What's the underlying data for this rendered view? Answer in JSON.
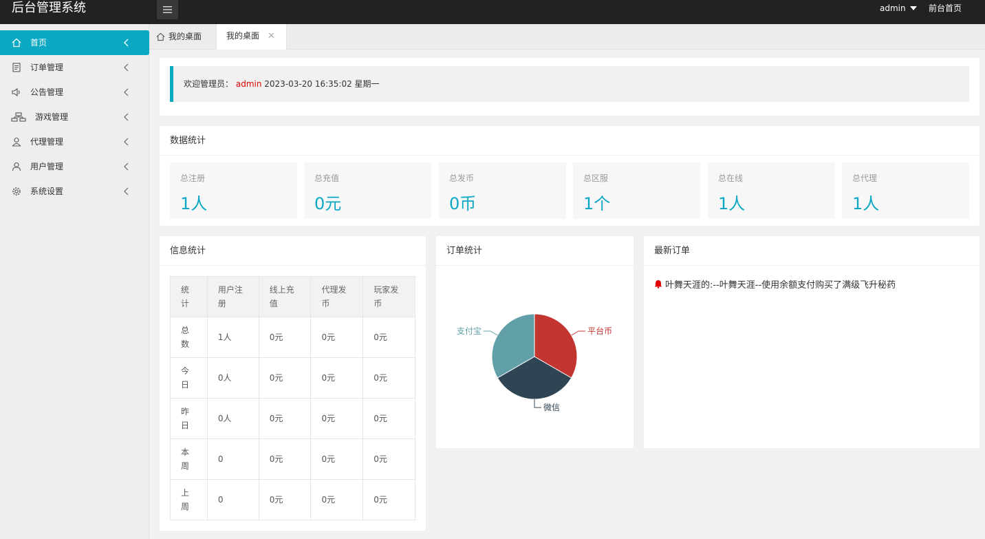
{
  "header": {
    "brand": "后台管理系统",
    "user": "admin",
    "front_home": "前台首页"
  },
  "sidebar": {
    "items": [
      {
        "label": "首页",
        "icon": "home-icon",
        "active": true
      },
      {
        "label": "订单管理",
        "icon": "order-icon",
        "active": false
      },
      {
        "label": "公告管理",
        "icon": "speaker-icon",
        "active": false
      },
      {
        "label": "游戏管理",
        "icon": "sitemap-icon",
        "active": false
      },
      {
        "label": "代理管理",
        "icon": "agent-icon",
        "active": false
      },
      {
        "label": "用户管理",
        "icon": "user-icon",
        "active": false
      },
      {
        "label": "系统设置",
        "icon": "gear-icon",
        "active": false
      }
    ]
  },
  "tabs": {
    "home_label": "我的桌面",
    "active_label": "我的桌面",
    "close_glyph": "✕"
  },
  "welcome": {
    "prefix": "欢迎管理员：",
    "user": "admin",
    "datetime": "2023-03-20  16:35:02  星期一"
  },
  "stats": {
    "title": "数据统计",
    "cards": [
      {
        "label": "总注册",
        "value": "1人"
      },
      {
        "label": "总充值",
        "value": "0元"
      },
      {
        "label": "总发币",
        "value": "0币"
      },
      {
        "label": "总区服",
        "value": "1个"
      },
      {
        "label": "总在线",
        "value": "1人"
      },
      {
        "label": "总代理",
        "value": "1人"
      }
    ]
  },
  "info": {
    "title": "信息统计",
    "headers": [
      "统计",
      "用户注册",
      "线上充值",
      "代理发币",
      "玩家发币"
    ],
    "rows": [
      [
        "总数",
        "1人",
        "0元",
        "0元",
        "0元"
      ],
      [
        "今日",
        "0人",
        "0元",
        "0元",
        "0元"
      ],
      [
        "昨日",
        "0人",
        "0元",
        "0元",
        "0元"
      ],
      [
        "本周",
        "0",
        "0元",
        "0元",
        "0元"
      ],
      [
        "上周",
        "0",
        "0元",
        "0元",
        "0元"
      ]
    ]
  },
  "orders": {
    "title": "订单统计"
  },
  "latest": {
    "title": "最新订单",
    "items": [
      "叶舞天涯的:--叶舞天涯--使用余额支付购买了满级飞升秘药"
    ]
  },
  "colors": {
    "accent": "#0aa8c3",
    "header_bg": "#222222",
    "welcome_user": "#e00000"
  },
  "chart_data": {
    "type": "pie",
    "title": "",
    "categories": [
      "平台币",
      "微信",
      "支付宝"
    ],
    "values": [
      1,
      1,
      1
    ],
    "colors": [
      "#c23531",
      "#2f4554",
      "#61a0a8"
    ]
  }
}
